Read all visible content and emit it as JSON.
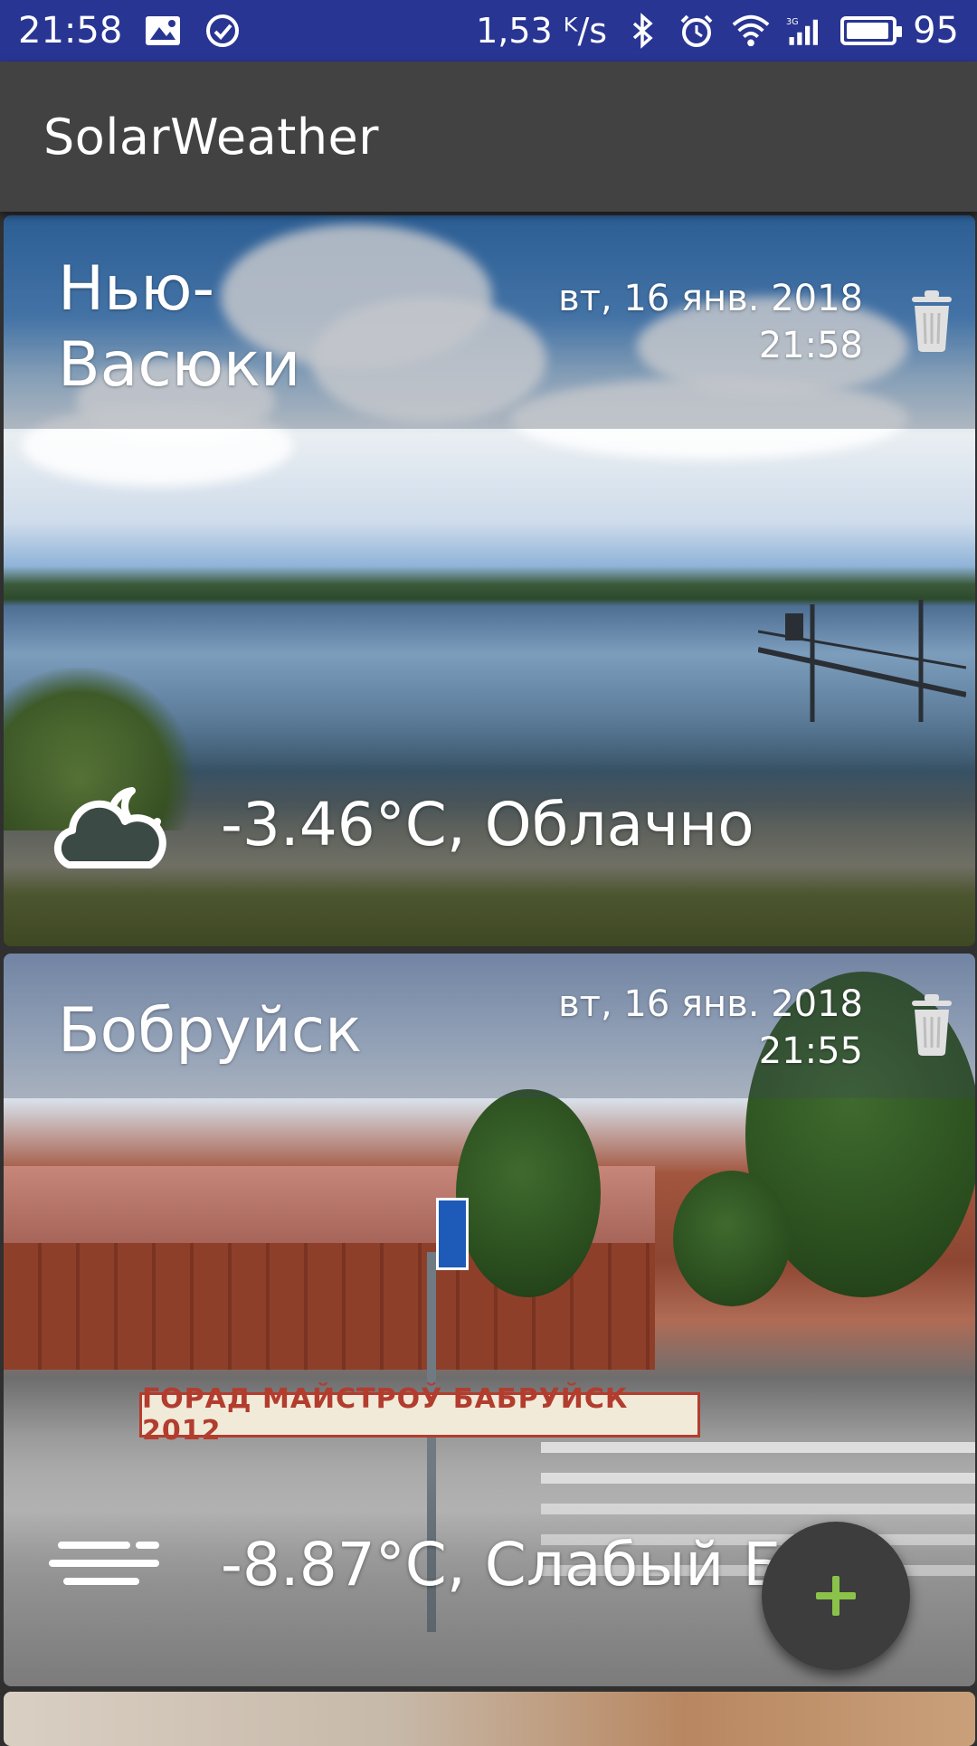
{
  "status_bar": {
    "time": "21:58",
    "net_speed": "1,53 ᴷ/s",
    "battery": "95",
    "battery_level": 0.95,
    "icons": [
      "image-notification-icon",
      "check-circle-icon",
      "bluetooth-icon",
      "alarm-icon",
      "wifi-icon",
      "signal-3g-icon",
      "battery-icon"
    ]
  },
  "toolbar": {
    "title": "SolarWeather"
  },
  "cards": [
    {
      "city": "Нью-Васюки",
      "date": "вт, 16 янв. 2018",
      "time": "21:58",
      "weather": "-3.46°C, Облачно",
      "weather_icon": "cloudy-night-icon"
    },
    {
      "city": "Бобруйск",
      "date": "вт, 16 янв. 2018",
      "time": "21:55",
      "weather": "-8.87°C, Слабый Бриз",
      "weather_icon": "wind-icon"
    }
  ],
  "photo_text": {
    "banner": "ГОРАД МАЙСТРОЎ    БАБРУЙСК 2012"
  },
  "fab": {
    "icon": "plus-icon",
    "accent": "#8bc34a"
  },
  "colors": {
    "status_bar": "#283593",
    "toolbar": "#424242",
    "background": "#303030"
  }
}
